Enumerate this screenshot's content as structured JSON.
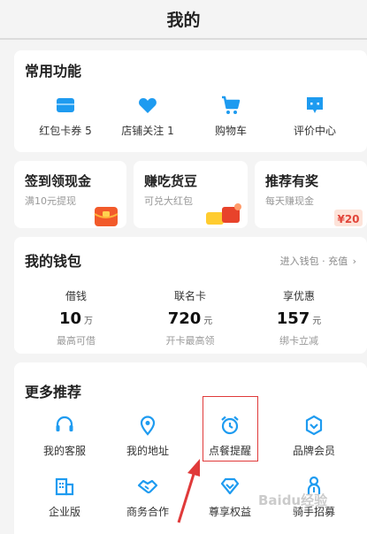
{
  "header": {
    "title": "我的"
  },
  "common": {
    "title": "常用功能",
    "items": [
      {
        "label": "红包卡券 5",
        "icon": "coupon-icon"
      },
      {
        "label": "店铺关注 1",
        "icon": "heart-icon"
      },
      {
        "label": "购物车",
        "icon": "cart-icon"
      },
      {
        "label": "评价中心",
        "icon": "review-icon"
      }
    ]
  },
  "promos": [
    {
      "title": "签到领现金",
      "sub": "满10元提现"
    },
    {
      "title": "赚吃货豆",
      "sub": "可兑大红包"
    },
    {
      "title": "推荐有奖",
      "sub": "每天赚现金",
      "badge": "¥20"
    }
  ],
  "wallet": {
    "title": "我的钱包",
    "link": "进入钱包 · 充值",
    "cols": [
      {
        "label": "借钱",
        "value": "10",
        "unit": "万",
        "sub": "最高可借"
      },
      {
        "label": "联名卡",
        "value": "720",
        "unit": "元",
        "sub": "开卡最高领"
      },
      {
        "label": "享优惠",
        "value": "157",
        "unit": "元",
        "sub": "绑卡立减"
      }
    ]
  },
  "more": {
    "title": "更多推荐",
    "items": [
      {
        "label": "我的客服",
        "icon": "headset-icon"
      },
      {
        "label": "我的地址",
        "icon": "location-icon"
      },
      {
        "label": "点餐提醒",
        "icon": "alarm-clock-icon"
      },
      {
        "label": "品牌会员",
        "icon": "brand-member-icon"
      },
      {
        "label": "企业版",
        "icon": "enterprise-icon"
      },
      {
        "label": "商务合作",
        "icon": "handshake-icon"
      },
      {
        "label": "尊享权益",
        "icon": "diamond-icon"
      },
      {
        "label": "骑手招募",
        "icon": "rider-icon"
      }
    ]
  },
  "watermark": "Baidu经验",
  "colors": {
    "accent": "#1e9bf0",
    "highlight": "#e03a3a",
    "background": "#f4f4f4"
  }
}
